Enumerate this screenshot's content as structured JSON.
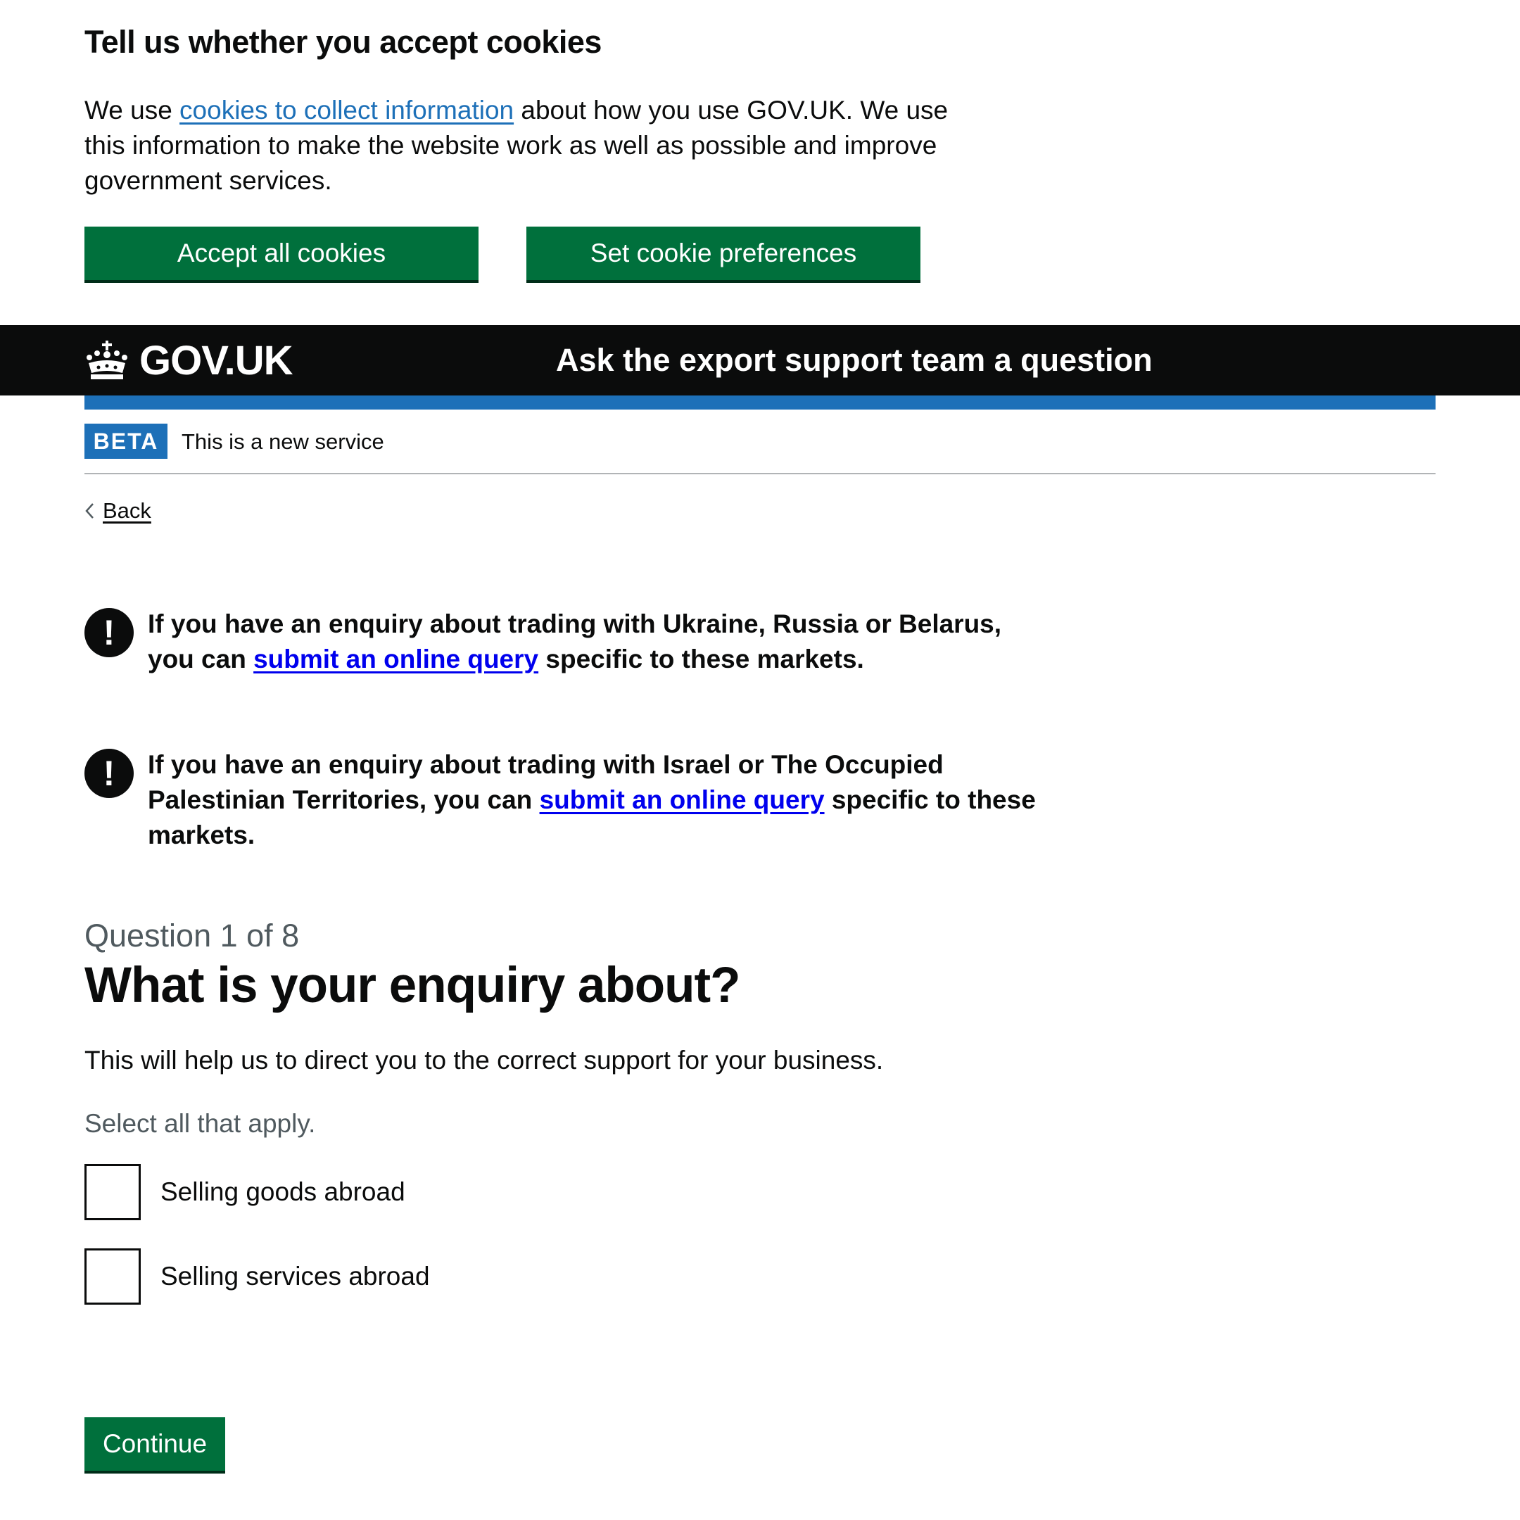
{
  "cookie_banner": {
    "heading": "Tell us whether you accept cookies",
    "text_before_link": "We use ",
    "link_text": "cookies to collect information",
    "text_after_link": " about how you use GOV.UK. We use this information to make the website work as well as possible and improve government services.",
    "accept_button": "Accept all cookies",
    "preferences_button": "Set cookie preferences"
  },
  "header": {
    "logo_text": "GOV.UK",
    "service_name": "Ask the export support team a question"
  },
  "phase_banner": {
    "tag": "BETA",
    "text": "This is a new service"
  },
  "back_link": "Back",
  "warnings": [
    {
      "icon": "!",
      "before": "If you have an enquiry about trading with Ukraine, Russia or Belarus, you can ",
      "link": "submit an online query",
      "after": " specific to these markets."
    },
    {
      "icon": "!",
      "before": "If you have an enquiry about trading with Israel or The Occupied Palestinian Territories, you can ",
      "link": "submit an online query",
      "after": " specific to these markets."
    }
  ],
  "question": {
    "caption": "Question 1 of 8",
    "title": "What is your enquiry about?",
    "hint": "This will help us to direct you to the correct support for your business.",
    "select_hint": "Select all that apply.",
    "options": [
      {
        "label": "Selling goods abroad",
        "checked": false
      },
      {
        "label": "Selling services abroad",
        "checked": false
      }
    ]
  },
  "continue_button": "Continue",
  "colors": {
    "button_green": "#00703c",
    "header_black": "#0b0c0c",
    "brand_blue": "#1d70b8",
    "link_blue": "#1d70b8",
    "warning_link": "#0000ee",
    "secondary_text": "#505a5f"
  }
}
